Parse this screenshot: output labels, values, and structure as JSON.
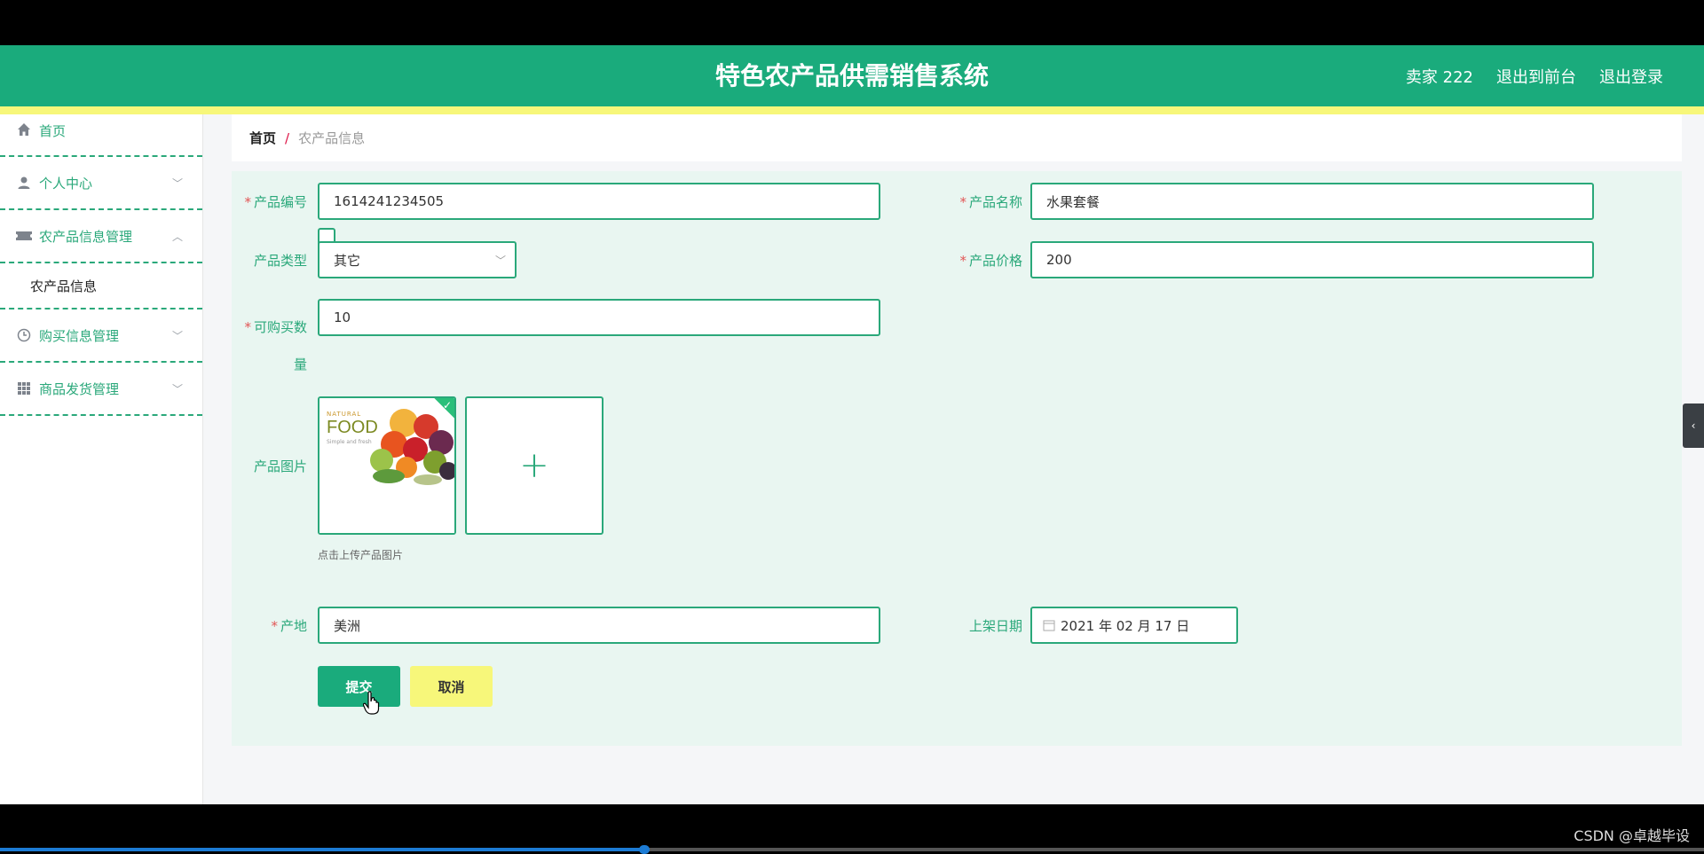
{
  "header": {
    "title": "特色农产品供需销售系统",
    "user": "卖家 222",
    "back_front": "退出到前台",
    "logout": "退出登录"
  },
  "sidebar": {
    "items": [
      {
        "label": "首页",
        "icon": "home-icon"
      },
      {
        "label": "个人中心",
        "icon": "user-icon"
      },
      {
        "label": "农产品信息管理",
        "icon": "ticket-icon",
        "expanded": true,
        "children": [
          "农产品信息"
        ]
      },
      {
        "label": "购买信息管理",
        "icon": "clock-icon"
      },
      {
        "label": "商品发货管理",
        "icon": "grid-icon"
      }
    ]
  },
  "breadcrumb": {
    "home": "首页",
    "sep": "/",
    "current": "农产品信息"
  },
  "form": {
    "product_no": {
      "label": "产品编号",
      "value": "1614241234505",
      "required": true
    },
    "product_name": {
      "label": "产品名称",
      "value": "水果套餐",
      "required": true
    },
    "product_type": {
      "label": "产品类型",
      "value": "其它"
    },
    "product_price": {
      "label": "产品价格",
      "value": "200",
      "required": true
    },
    "buy_qty": {
      "label_line1": "可购买数",
      "label_line2": "量",
      "value": "10",
      "required": true
    },
    "image": {
      "label": "产品图片",
      "hint": "点击上传产品图片",
      "thumb_brand": "NATURAL",
      "thumb_title": "FOOD",
      "thumb_sub": "Simple and fresh",
      "add": "+"
    },
    "origin": {
      "label": "产地",
      "value": "美洲",
      "required": true
    },
    "list_date": {
      "label": "上架日期",
      "value": "2021 年 02 月 17 日"
    },
    "submit": "提交",
    "cancel": "取消"
  },
  "required_mark": "*",
  "video": {
    "progress": 0.378,
    "watermark": "CSDN @卓越毕设"
  },
  "colors": {
    "primary": "#1aab7c",
    "accent_yellow": "#f7f77a",
    "form_bg": "#e9f6f1"
  }
}
